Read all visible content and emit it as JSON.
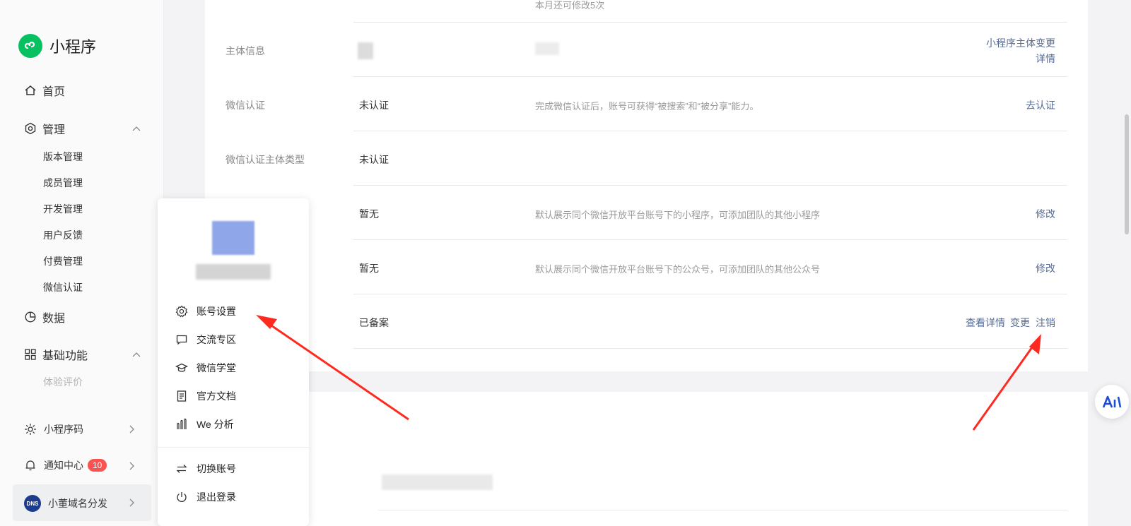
{
  "app": {
    "title": "小程序"
  },
  "sidebar": {
    "home": "首页",
    "manage": {
      "label": "管理",
      "items": [
        "版本管理",
        "成员管理",
        "开发管理",
        "用户反馈",
        "付费管理",
        "微信认证"
      ]
    },
    "data": "数据",
    "basic": {
      "label": "基础功能",
      "items": [
        "体验评价"
      ]
    },
    "qrcode": "小程序码",
    "notify": {
      "label": "通知中心",
      "count": "10"
    },
    "account": "小董域名分发"
  },
  "info_table": {
    "top_note": "本月还可修改5次",
    "rows": [
      {
        "label": "主体信息",
        "value": "",
        "desc": "",
        "actions": [
          "小程序主体变更",
          "详情"
        ]
      },
      {
        "label": "微信认证",
        "value": "未认证",
        "desc": "完成微信认证后，账号可获得“被搜索”和“被分享”能力。",
        "actions": [
          "去认证"
        ]
      },
      {
        "label": "微信认证主体类型",
        "value": "未认证",
        "desc": "",
        "actions": []
      },
      {
        "label": "",
        "value": "暂无",
        "desc": "默认展示同个微信开放平台账号下的小程序，可添加团队的其他小程序",
        "actions": [
          "修改"
        ]
      },
      {
        "label": "",
        "value": "暂无",
        "desc": "默认展示同个微信开放平台账号下的公众号，可添加团队的其他公众号",
        "actions": [
          "修改"
        ]
      },
      {
        "label": "",
        "value": "已备案",
        "desc": "",
        "actions": [
          "查看详情",
          "变更",
          "注销"
        ]
      }
    ]
  },
  "popover": {
    "items": [
      "账号设置",
      "交流专区",
      "微信学堂",
      "官方文档",
      "We 分析"
    ],
    "footer_items": [
      "切换账号",
      "退出登录"
    ]
  },
  "colors": {
    "accent": "#576b95",
    "brand": "#07c160",
    "badge": "#fa5151",
    "arrow": "#ff2a1f"
  }
}
